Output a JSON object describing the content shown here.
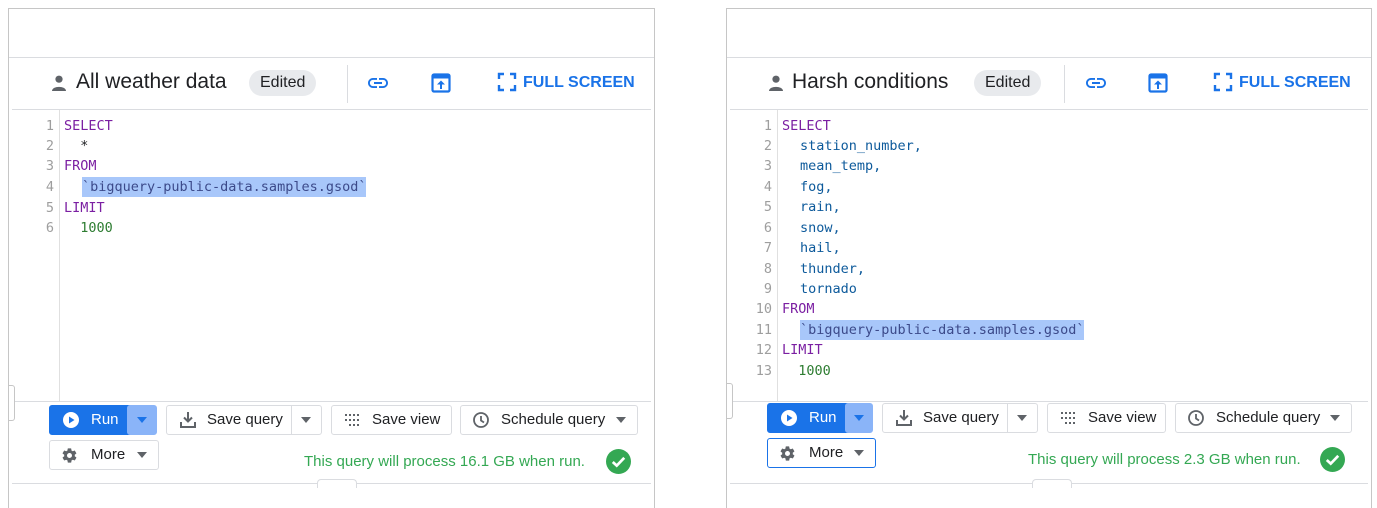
{
  "left_panel": {
    "title": "All weather data",
    "badge": "Edited",
    "fullscreen_label": "FULL SCREEN",
    "code_lines": [
      {
        "num": "1",
        "text": "SELECT",
        "type": "kw"
      },
      {
        "num": "2",
        "text": "  *",
        "type": "plain"
      },
      {
        "num": "3",
        "text": "FROM",
        "type": "kw"
      },
      {
        "num": "4",
        "text": "`bigquery-public-data.samples.gsod`",
        "type": "table"
      },
      {
        "num": "5",
        "text": "LIMIT",
        "type": "kw"
      },
      {
        "num": "6",
        "text": "  1000",
        "type": "num"
      }
    ],
    "run_label": "Run",
    "save_query_label": "Save query",
    "save_view_label": "Save view",
    "schedule_label": "Schedule query",
    "more_label": "More",
    "status_text": "This query will process 16.1 GB when run."
  },
  "right_panel": {
    "title": "Harsh conditions",
    "badge": "Edited",
    "fullscreen_label": "FULL SCREEN",
    "code_lines": [
      {
        "num": "1",
        "text": "SELECT",
        "type": "kw"
      },
      {
        "num": "2",
        "text": "station_number,",
        "type": "id"
      },
      {
        "num": "3",
        "text": "mean_temp,",
        "type": "id"
      },
      {
        "num": "4",
        "text": "fog,",
        "type": "id"
      },
      {
        "num": "5",
        "text": "rain,",
        "type": "id"
      },
      {
        "num": "6",
        "text": "snow,",
        "type": "id"
      },
      {
        "num": "7",
        "text": "hail,",
        "type": "id"
      },
      {
        "num": "8",
        "text": "thunder,",
        "type": "id"
      },
      {
        "num": "9",
        "text": "tornado",
        "type": "id"
      },
      {
        "num": "10",
        "text": "FROM",
        "type": "kw"
      },
      {
        "num": "11",
        "text": "`bigquery-public-data.samples.gsod`",
        "type": "table"
      },
      {
        "num": "12",
        "text": "LIMIT",
        "type": "kw"
      },
      {
        "num": "13",
        "text": "  1000",
        "type": "num"
      }
    ],
    "run_label": "Run",
    "save_query_label": "Save query",
    "save_view_label": "Save view",
    "schedule_label": "Schedule query",
    "more_label": "More",
    "status_text": "This query will process 2.3 GB when run."
  },
  "colors": {
    "accent": "#1a73e8",
    "keyword": "#7b1fa2",
    "identifier": "#0d5a9b",
    "number": "#2e7d32",
    "highlight": "#a8c7fa",
    "status_green": "#34a853"
  },
  "icons": [
    "person-icon",
    "link-icon",
    "open-in-new-icon",
    "fullscreen-icon",
    "play-icon",
    "download-icon",
    "grid-icon",
    "clock-icon",
    "gear-icon",
    "chevron-down-icon",
    "check-circle-icon"
  ]
}
